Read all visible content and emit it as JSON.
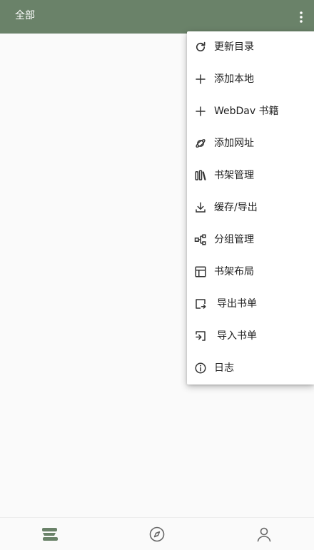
{
  "header": {
    "title": "全部",
    "overflow_icon": "more-vert-icon"
  },
  "menu": {
    "items": [
      {
        "label": "更新目录",
        "icon": "refresh-icon"
      },
      {
        "label": "添加本地",
        "icon": "plus-icon"
      },
      {
        "label": "WebDav 书籍",
        "icon": "plus-icon"
      },
      {
        "label": "添加网址",
        "icon": "planet-link-icon"
      },
      {
        "label": "书架管理",
        "icon": "bookshelf-icon"
      },
      {
        "label": "缓存/导出",
        "icon": "download-icon"
      },
      {
        "label": "分组管理",
        "icon": "group-tree-icon"
      },
      {
        "label": "书架布局",
        "icon": "layout-icon"
      },
      {
        "label": "导出书单",
        "icon": "export-icon"
      },
      {
        "label": "导入书单",
        "icon": "import-icon"
      },
      {
        "label": "日志",
        "icon": "info-icon"
      }
    ]
  },
  "bottom_nav": {
    "items": [
      {
        "icon": "bookshelf-nav-icon",
        "active": true
      },
      {
        "icon": "compass-icon",
        "active": false
      },
      {
        "icon": "person-icon",
        "active": false
      }
    ]
  },
  "colors": {
    "accent": "#6a8269",
    "icon": "#333333",
    "inactive_nav": "#666666"
  }
}
